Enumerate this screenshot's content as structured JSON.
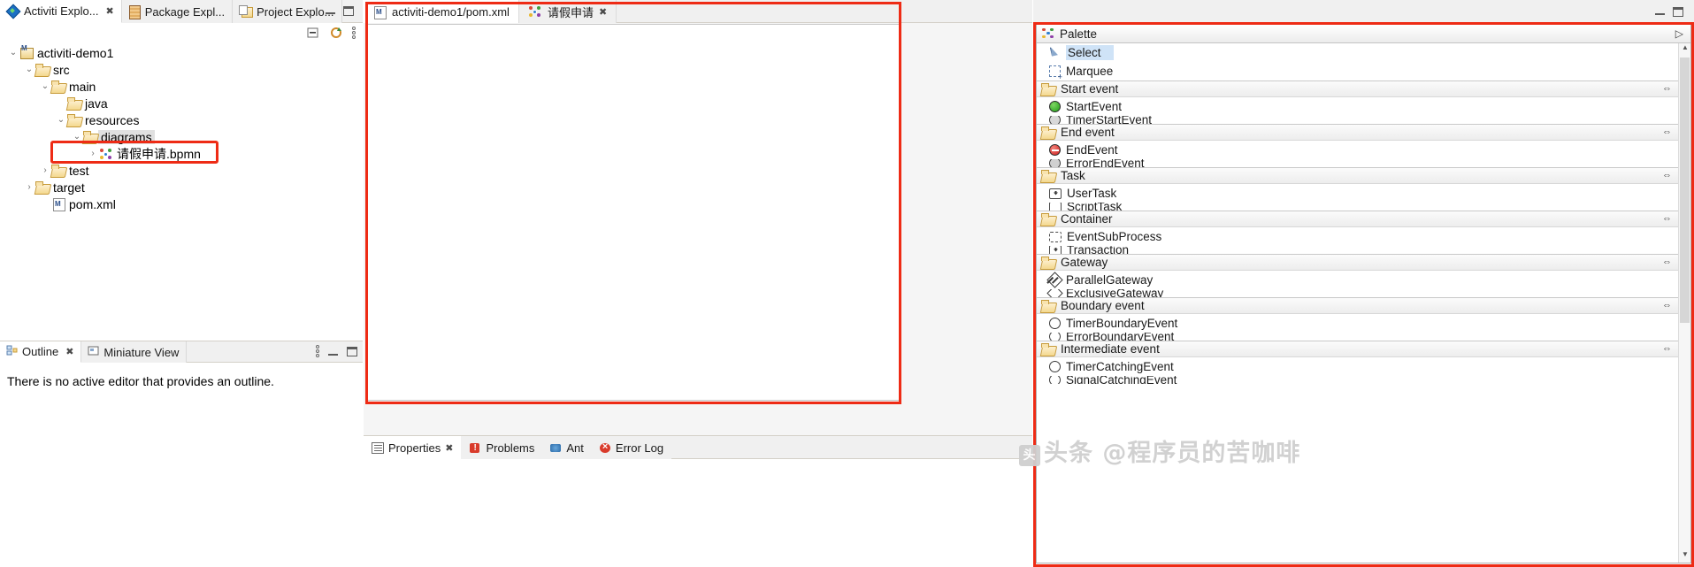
{
  "left_panel": {
    "tabs": [
      {
        "label": "Activiti Explo...",
        "icon": "activiti-icon",
        "active": true,
        "closable": true
      },
      {
        "label": "Package Expl...",
        "icon": "package-icon",
        "active": false,
        "closable": false
      },
      {
        "label": "Project Explo...",
        "icon": "project-icon",
        "active": false,
        "closable": false
      }
    ],
    "tree": [
      {
        "label": "activiti-demo1",
        "depth": 0,
        "arrow": "v",
        "icon": "project-maven-icon",
        "selected": false
      },
      {
        "label": "src",
        "depth": 1,
        "arrow": "v",
        "icon": "folder-icon",
        "selected": false
      },
      {
        "label": "main",
        "depth": 2,
        "arrow": "v",
        "icon": "folder-icon",
        "selected": false
      },
      {
        "label": "java",
        "depth": 3,
        "arrow": "",
        "icon": "folder-icon",
        "selected": false
      },
      {
        "label": "resources",
        "depth": 3,
        "arrow": "v",
        "icon": "folder-icon",
        "selected": false
      },
      {
        "label": "diagrams",
        "depth": 4,
        "arrow": "v",
        "icon": "folder-icon",
        "selected": true
      },
      {
        "label": "请假申请.bpmn",
        "depth": 5,
        "arrow": ">",
        "icon": "bpmn-icon",
        "selected": false
      },
      {
        "label": "test",
        "depth": 2,
        "arrow": ">",
        "icon": "folder-icon",
        "selected": false
      },
      {
        "label": "target",
        "depth": 1,
        "arrow": ">",
        "icon": "folder-icon",
        "selected": false
      },
      {
        "label": "pom.xml",
        "depth": 2,
        "arrow": "",
        "icon": "xml-file-icon",
        "selected": false
      }
    ]
  },
  "outline_panel": {
    "tabs": [
      {
        "label": "Outline",
        "icon": "outline-icon",
        "active": true,
        "closable": true
      },
      {
        "label": "Miniature View",
        "icon": "miniature-icon",
        "active": false,
        "closable": false
      }
    ],
    "message": "There is no active editor that provides an outline."
  },
  "editor": {
    "tabs": [
      {
        "label": "activiti-demo1/pom.xml",
        "icon": "maven-pom-icon",
        "active": true,
        "closable": false
      },
      {
        "label": "请假申请",
        "icon": "bpmn-icon",
        "active": false,
        "closable": true
      }
    ]
  },
  "bottom_views": {
    "tabs": [
      {
        "label": "Properties",
        "icon": "properties-icon",
        "active": true,
        "closable": true
      },
      {
        "label": "Problems",
        "icon": "problems-icon",
        "active": false,
        "closable": false
      },
      {
        "label": "Ant",
        "icon": "ant-icon",
        "active": false,
        "closable": false
      },
      {
        "label": "Error Log",
        "icon": "error-log-icon",
        "active": false,
        "closable": false
      }
    ]
  },
  "palette": {
    "title": "Palette",
    "pin_glyph": "▷",
    "collapse_glyph": "⇔",
    "tools": [
      {
        "label": "Select",
        "icon": "cursor-icon",
        "selected": true
      },
      {
        "label": "Marquee",
        "icon": "marquee-icon",
        "selected": false
      }
    ],
    "groups": [
      {
        "name": "Start event",
        "items": [
          {
            "label": "StartEvent",
            "icon": "start-event-icon",
            "clipped": false
          },
          {
            "label": "TimerStartEvent",
            "icon": "timer-start-event-icon",
            "clipped": true
          }
        ]
      },
      {
        "name": "End event",
        "items": [
          {
            "label": "EndEvent",
            "icon": "end-event-icon",
            "clipped": false
          },
          {
            "label": "ErrorEndEvent",
            "icon": "error-end-event-icon",
            "clipped": true
          }
        ]
      },
      {
        "name": "Task",
        "items": [
          {
            "label": "UserTask",
            "icon": "user-task-icon",
            "clipped": false
          },
          {
            "label": "ScriptTask",
            "icon": "script-task-icon",
            "clipped": true
          }
        ]
      },
      {
        "name": "Container",
        "items": [
          {
            "label": "EventSubProcess",
            "icon": "event-subprocess-icon",
            "clipped": false
          },
          {
            "label": "Transaction",
            "icon": "transaction-icon",
            "clipped": true
          }
        ]
      },
      {
        "name": "Gateway",
        "items": [
          {
            "label": "ParallelGateway",
            "icon": "parallel-gateway-icon",
            "clipped": false
          },
          {
            "label": "ExclusiveGateway",
            "icon": "exclusive-gateway-icon",
            "clipped": true
          }
        ]
      },
      {
        "name": "Boundary event",
        "items": [
          {
            "label": "TimerBoundaryEvent",
            "icon": "timer-boundary-event-icon",
            "clipped": false
          },
          {
            "label": "ErrorBoundaryEvent",
            "icon": "error-boundary-event-icon",
            "clipped": true
          }
        ]
      },
      {
        "name": "Intermediate event",
        "items": [
          {
            "label": "TimerCatchingEvent",
            "icon": "timer-catching-event-icon",
            "clipped": false
          },
          {
            "label": "SignalCatchingEvent",
            "icon": "signal-catching-event-icon",
            "clipped": true
          }
        ]
      }
    ]
  },
  "watermark": {
    "text": "头条 @程序员的苦咖啡"
  },
  "colors": {
    "highlight_box": "#ee2b15",
    "selection": "#cfe3f7",
    "tree_selection": "#e0e0e0",
    "chrome": "#f0f0f0"
  }
}
